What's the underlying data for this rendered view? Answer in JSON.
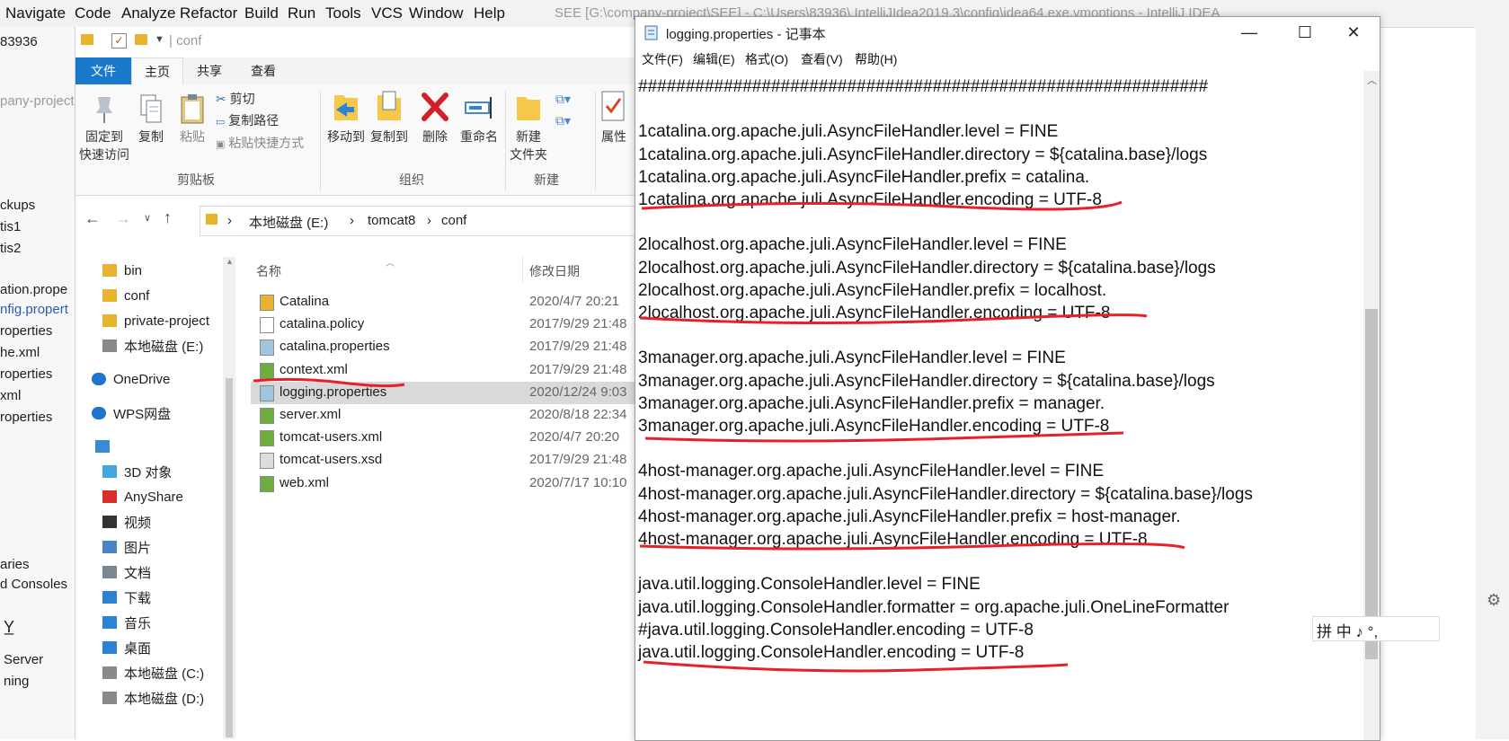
{
  "ide": {
    "menu": [
      {
        "label": "Navigate",
        "u": "N"
      },
      {
        "label": "Code",
        "u": "C"
      },
      {
        "label": "Analyze",
        "u": "z"
      },
      {
        "label": "Refactor",
        "u": "R"
      },
      {
        "label": "Build",
        "u": "B"
      },
      {
        "label": "Run",
        "u": "u"
      },
      {
        "label": "Tools",
        "u": "T"
      },
      {
        "label": "VCS",
        "u": "S"
      },
      {
        "label": "Window",
        "u": "W"
      },
      {
        "label": "Help",
        "u": "H"
      }
    ],
    "title": "SEE [G:\\company-project\\SEE] - C:\\Users\\83936\\.IntelliJIdea2019.3\\config\\idea64.exe.vmoptions - IntelliJ IDEA",
    "path_fragment": "83936",
    "tree": [
      "pany-project",
      "ckups",
      "tis1",
      "tis2",
      "ation.prope",
      "nfig.propert",
      "roperties",
      "he.xml",
      "roperties",
      "xml",
      "roperties",
      "aries",
      "d Consoles"
    ],
    "bottom": [
      "Server",
      "ning"
    ]
  },
  "explorer": {
    "breadcrumb_hint": "conf",
    "ribbon_tabs": [
      "文件",
      "主页",
      "共享",
      "查看"
    ],
    "ribbon": {
      "pin": [
        "固定到",
        "快速访问"
      ],
      "copy": "复制",
      "paste": "粘贴",
      "cut": "剪切",
      "copy_path": "复制路径",
      "paste_shortcut": "粘贴快捷方式",
      "clipboard_group": "剪贴板",
      "move_to": "移动到",
      "copy_to": "复制到",
      "delete": "删除",
      "rename": "重命名",
      "organize_group": "组织",
      "new_folder": [
        "新建",
        "文件夹"
      ],
      "new_group": "新建",
      "properties": "属性"
    },
    "address": [
      "本地磁盘 (E:)",
      "tomcat8",
      "conf"
    ],
    "nav": [
      {
        "label": "bin",
        "icon": "folder-icon"
      },
      {
        "label": "conf",
        "icon": "folder-icon"
      },
      {
        "label": "private-project",
        "icon": "folder-icon"
      },
      {
        "label": "本地磁盘 (E:)",
        "icon": "drive-icon"
      },
      {
        "label": "OneDrive",
        "icon": "cloud-icon"
      },
      {
        "label": "WPS网盘",
        "icon": "cloud-icon"
      },
      {
        "label": "",
        "icon": "computer-icon"
      },
      {
        "label": "3D 对象",
        "icon": "cube-icon"
      },
      {
        "label": "AnyShare",
        "icon": "share-icon"
      },
      {
        "label": "视频",
        "icon": "video-icon"
      },
      {
        "label": "图片",
        "icon": "picture-icon"
      },
      {
        "label": "文档",
        "icon": "document-icon"
      },
      {
        "label": "下载",
        "icon": "download-icon"
      },
      {
        "label": "音乐",
        "icon": "music-icon"
      },
      {
        "label": "桌面",
        "icon": "desktop-icon"
      },
      {
        "label": "本地磁盘 (C:)",
        "icon": "drive-icon"
      },
      {
        "label": "本地磁盘 (D:)",
        "icon": "drive-icon"
      }
    ],
    "columns": {
      "name": "名称",
      "date": "修改日期"
    },
    "files": [
      {
        "name": "Catalina",
        "date": "2020/4/7 20:21",
        "icon": "folder-icon"
      },
      {
        "name": "catalina.policy",
        "date": "2017/9/29 21:48",
        "icon": "file-icon"
      },
      {
        "name": "catalina.properties",
        "date": "2017/9/29 21:48",
        "icon": "properties-icon"
      },
      {
        "name": "context.xml",
        "date": "2017/9/29 21:48",
        "icon": "xml-icon"
      },
      {
        "name": "logging.properties",
        "date": "2020/12/24 9:03",
        "icon": "properties-icon",
        "selected": true
      },
      {
        "name": "server.xml",
        "date": "2020/8/18 22:34",
        "icon": "xml-icon"
      },
      {
        "name": "tomcat-users.xml",
        "date": "2020/4/7 20:20",
        "icon": "xml-icon"
      },
      {
        "name": "tomcat-users.xsd",
        "date": "2017/9/29 21:48",
        "icon": "xsd-icon"
      },
      {
        "name": "web.xml",
        "date": "2020/7/17 10:10",
        "icon": "xml-icon"
      }
    ]
  },
  "notepad": {
    "title": "logging.properties - 记事本",
    "menu": [
      "文件(F)",
      "编辑(E)",
      "格式(O)",
      "查看(V)",
      "帮助(H)"
    ],
    "lines": [
      "############################################################",
      "",
      "1catalina.org.apache.juli.AsyncFileHandler.level = FINE",
      "1catalina.org.apache.juli.AsyncFileHandler.directory = ${catalina.base}/logs",
      "1catalina.org.apache.juli.AsyncFileHandler.prefix = catalina.",
      "1catalina.org.apache.juli.AsyncFileHandler.encoding = UTF-8",
      "",
      "2localhost.org.apache.juli.AsyncFileHandler.level = FINE",
      "2localhost.org.apache.juli.AsyncFileHandler.directory = ${catalina.base}/logs",
      "2localhost.org.apache.juli.AsyncFileHandler.prefix = localhost.",
      "2localhost.org.apache.juli.AsyncFileHandler.encoding = UTF-8",
      "",
      "3manager.org.apache.juli.AsyncFileHandler.level = FINE",
      "3manager.org.apache.juli.AsyncFileHandler.directory = ${catalina.base}/logs",
      "3manager.org.apache.juli.AsyncFileHandler.prefix = manager.",
      "3manager.org.apache.juli.AsyncFileHandler.encoding = UTF-8",
      "",
      "4host-manager.org.apache.juli.AsyncFileHandler.level = FINE",
      "4host-manager.org.apache.juli.AsyncFileHandler.directory = ${catalina.base}/logs",
      "4host-manager.org.apache.juli.AsyncFileHandler.prefix = host-manager.",
      "4host-manager.org.apache.juli.AsyncFileHandler.encoding = UTF-8",
      "",
      "java.util.logging.ConsoleHandler.level = FINE",
      "java.util.logging.ConsoleHandler.formatter = org.apache.juli.OneLineFormatter",
      "#java.util.logging.ConsoleHandler.encoding = UTF-8",
      "java.util.logging.ConsoleHandler.encoding = UTF-8"
    ]
  },
  "ime": {
    "text": "拼 中 ♪ °,"
  },
  "colors": {
    "annotation": "#e8202a",
    "selection": "#d9d9d9",
    "accent": "#1979ca"
  }
}
